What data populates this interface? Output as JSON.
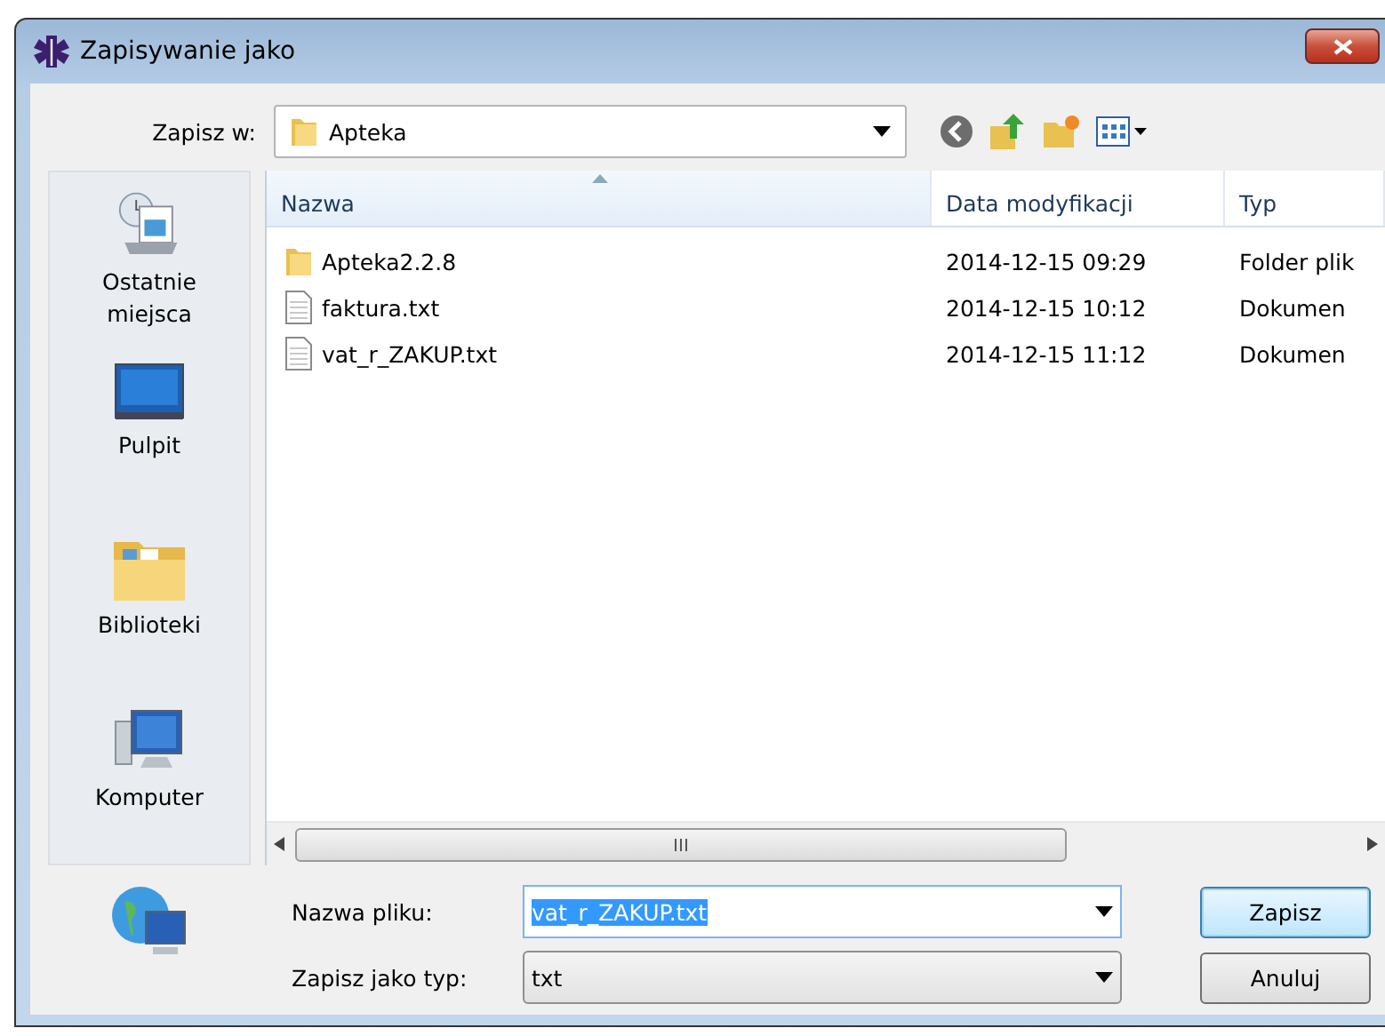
{
  "window": {
    "title": "Zapisywanie jako"
  },
  "location": {
    "label": "Zapisz w:",
    "value": "Apteka"
  },
  "sidebar": {
    "items": [
      {
        "kind": "recent",
        "label": "Ostatnie miejsca"
      },
      {
        "kind": "desktop",
        "label": "Pulpit"
      },
      {
        "kind": "libraries",
        "label": "Biblioteki"
      },
      {
        "kind": "computer",
        "label": "Komputer"
      },
      {
        "kind": "network"
      }
    ]
  },
  "table": {
    "columns": [
      {
        "label": "Nazwa",
        "sorted": true
      },
      {
        "label": "Data modyfikacji",
        "sorted": false
      },
      {
        "label": "Typ",
        "sorted": false
      }
    ],
    "rows": [
      {
        "kind": "folder",
        "name": "Apteka2.2.8",
        "date": "2014-12-15 09:29",
        "type": "Folder plik"
      },
      {
        "kind": "file",
        "name": "faktura.txt",
        "date": "2014-12-15 10:12",
        "type": "Dokumen"
      },
      {
        "kind": "file",
        "name": "vat_r_ZAKUP.txt",
        "date": "2014-12-15 11:12",
        "type": "Dokumen"
      }
    ]
  },
  "filename": {
    "label": "Nazwa pliku:",
    "value": "vat_r_ZAKUP.txt",
    "selected": true
  },
  "filetype": {
    "label": "Zapisz jako typ:",
    "value": "txt"
  },
  "buttons": [
    {
      "label": "Zapisz",
      "default": true
    },
    {
      "label": "Anuluj",
      "default": false
    }
  ]
}
